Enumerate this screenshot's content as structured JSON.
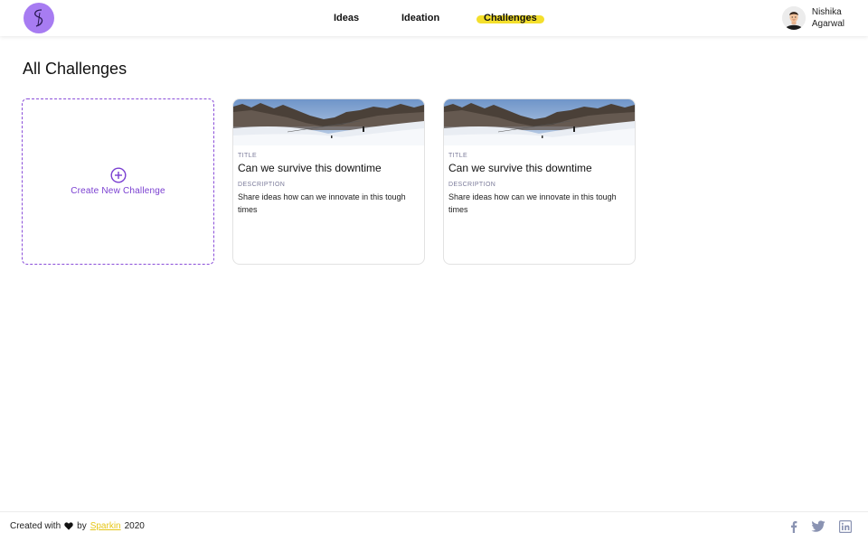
{
  "header": {
    "nav": [
      {
        "label": "Ideas"
      },
      {
        "label": "Ideation"
      },
      {
        "label": "Challenges",
        "active": true
      }
    ],
    "user": {
      "first_name": "Nishika",
      "last_name": "Agarwal"
    }
  },
  "main": {
    "title": "All Challenges",
    "create_label": "Create New Challenge",
    "cards": [
      {
        "title_caption": "TITLE",
        "title": "Can we survive this downtime",
        "desc_caption": "DESCRIPTION",
        "description": "Share ideas how can we innovate in this tough times"
      },
      {
        "title_caption": "TITLE",
        "title": "Can we survive this downtime",
        "desc_caption": "DESCRIPTION",
        "description": "Share ideas how can we innovate in this tough times"
      }
    ]
  },
  "footer": {
    "created_with": "Created with",
    "by": "by",
    "brand": "Sparkin",
    "year": "2020",
    "social": [
      "facebook-icon",
      "twitter-icon",
      "linkedin-icon"
    ]
  },
  "colors": {
    "accent_purple": "#8b4fd9",
    "logo_bg": "#a77cf2",
    "highlight_yellow": "#f4df2c",
    "social_icon": "#8a93b2"
  }
}
